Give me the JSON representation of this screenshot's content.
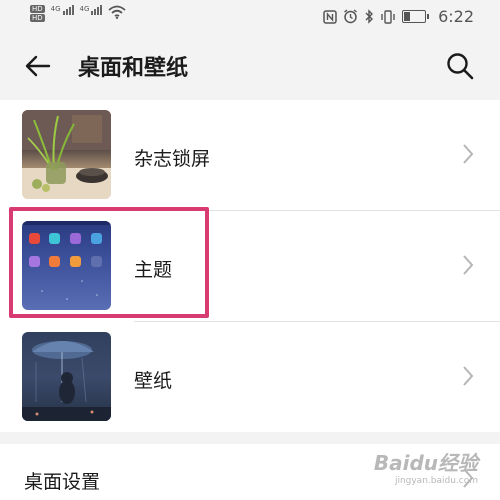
{
  "status_bar": {
    "hd_badges": [
      "HD",
      "HD"
    ],
    "network_labels": [
      "4G",
      "4G"
    ],
    "time": "6:22"
  },
  "header": {
    "title": "桌面和壁纸"
  },
  "settings_list": [
    {
      "label": "杂志锁屏"
    },
    {
      "label": "主题"
    },
    {
      "label": "壁纸"
    }
  ],
  "desktop_settings": {
    "label": "桌面设置"
  },
  "watermark": {
    "line1": "Baidu经验",
    "line2": "jingyan.baidu.com"
  }
}
